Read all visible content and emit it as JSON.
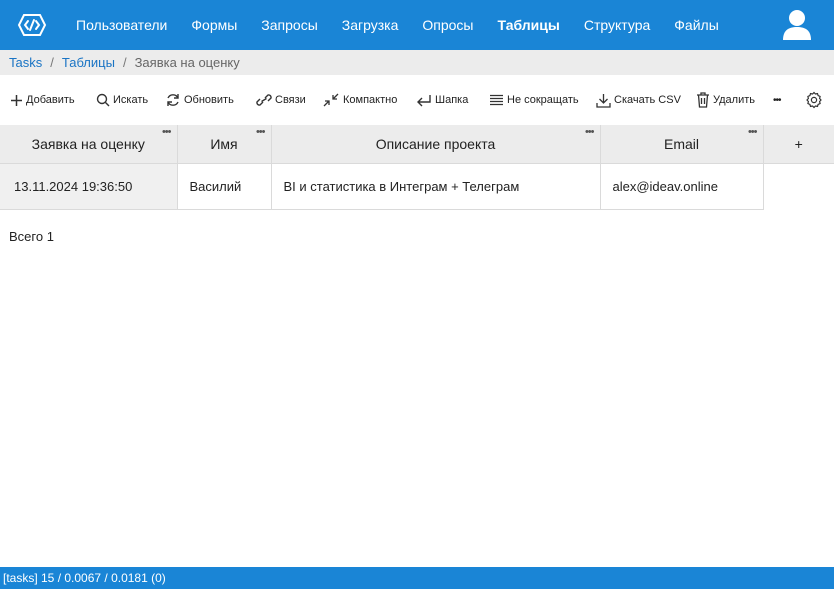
{
  "nav": {
    "items": [
      "Пользователи",
      "Формы",
      "Запросы",
      "Загрузка",
      "Опросы",
      "Таблицы",
      "Структура",
      "Файлы"
    ],
    "active": "Таблицы",
    "logo_icon": "logo-icon",
    "avatar_icon": "user-icon"
  },
  "breadcrumb": {
    "items": [
      "Tasks",
      "Таблицы"
    ],
    "current": "Заявка на оценку"
  },
  "toolbar": {
    "add": "Добавить",
    "search": "Искать",
    "refresh": "Обновить",
    "links": "Связи",
    "compact": "Компактно",
    "header": "Шапка",
    "no_truncate": "Не сокращать",
    "download_csv": "Скачать CSV",
    "delete": "Удалить",
    "more": "•••"
  },
  "table": {
    "columns": [
      "Заявка на оценку",
      "Имя",
      "Описание проекта",
      "Email"
    ],
    "add_column": "+",
    "col_menu": "•••",
    "rows": [
      [
        "13.11.2024 19:36:50",
        "Василий",
        "BI и статистика в Интеграм + Телеграм",
        "alex@ideav.online"
      ]
    ]
  },
  "total": "Всего 1",
  "footer": "[tasks] 15 / 0.0067 / 0.0181 (0)",
  "colors": {
    "primary": "#1a85d6",
    "header_bg": "#ececec"
  }
}
